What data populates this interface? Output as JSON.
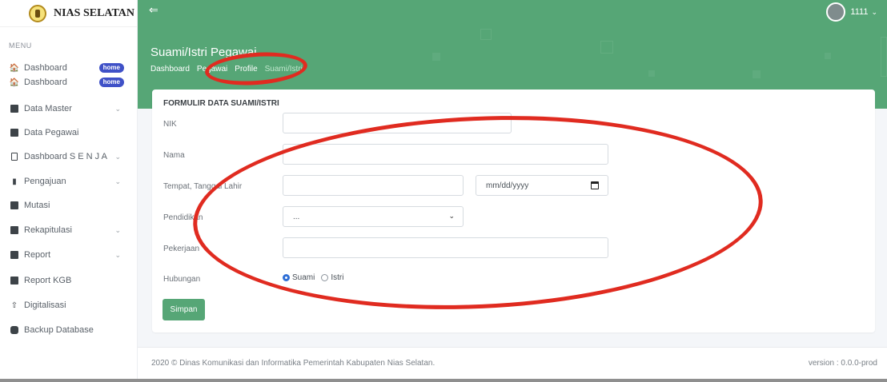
{
  "brand": {
    "name": "NIAS SELATAN"
  },
  "sidebar": {
    "menu_heading": "MENU",
    "items": [
      {
        "label": "Dashboard",
        "icon": "home-icon",
        "badge": "home"
      },
      {
        "label": "Dashboard",
        "icon": "home-icon",
        "badge": "home"
      },
      {
        "label": "Data Master",
        "icon": "table-icon",
        "chevron": "⌄"
      },
      {
        "label": "Data Pegawai",
        "icon": "id-card-icon"
      },
      {
        "label": "Dashboard S E N J A",
        "icon": "mobile-icon",
        "chevron": "⌄"
      },
      {
        "label": "Pengajuan",
        "icon": "chart-icon",
        "chevron": "⌄"
      },
      {
        "label": "Mutasi",
        "icon": "id-card-icon"
      },
      {
        "label": "Rekapitulasi",
        "icon": "book-icon",
        "chevron": "⌄"
      },
      {
        "label": "Report",
        "icon": "file-icon",
        "chevron": "⌄"
      },
      {
        "label": "Report KGB",
        "icon": "file-icon"
      },
      {
        "label": "Digitalisasi",
        "icon": "upload-icon"
      },
      {
        "label": "Backup Database",
        "icon": "database-icon"
      }
    ]
  },
  "topbar": {
    "toggle_icon": "⇐",
    "user_name": "1111",
    "user_chevron": "⌄"
  },
  "page": {
    "title": "Suami/Istri Pegawai",
    "breadcrumb": [
      "Dashboard",
      "Pegawai",
      "Profile",
      "Suami/Istri"
    ]
  },
  "form": {
    "title": "FORMULIR DATA SUAMI/ISTRI",
    "fields": {
      "nik": {
        "label": "NIK",
        "value": ""
      },
      "nama": {
        "label": "Nama",
        "value": ""
      },
      "ttl": {
        "label": "Tempat, Tanggal Lahir",
        "place": "",
        "date_placeholder": "mm/dd/yyyy"
      },
      "pendidikan": {
        "label": "Pendidikan",
        "selected": "..."
      },
      "pekerjaan": {
        "label": "Pekerjaan",
        "value": ""
      },
      "hubungan": {
        "label": "Hubungan",
        "options": [
          "Suami",
          "Istri"
        ],
        "selected": "Suami"
      }
    },
    "submit_label": "Simpan"
  },
  "footer": {
    "copyright": "2020 © Dinas Komunikasi dan Informatika Pemerintah Kabupaten Nias Selatan.",
    "version": "version : 0.0.0-prod"
  },
  "colors": {
    "primary": "#56a676",
    "badge": "#3f51c7",
    "annotation": "#e02b20"
  }
}
